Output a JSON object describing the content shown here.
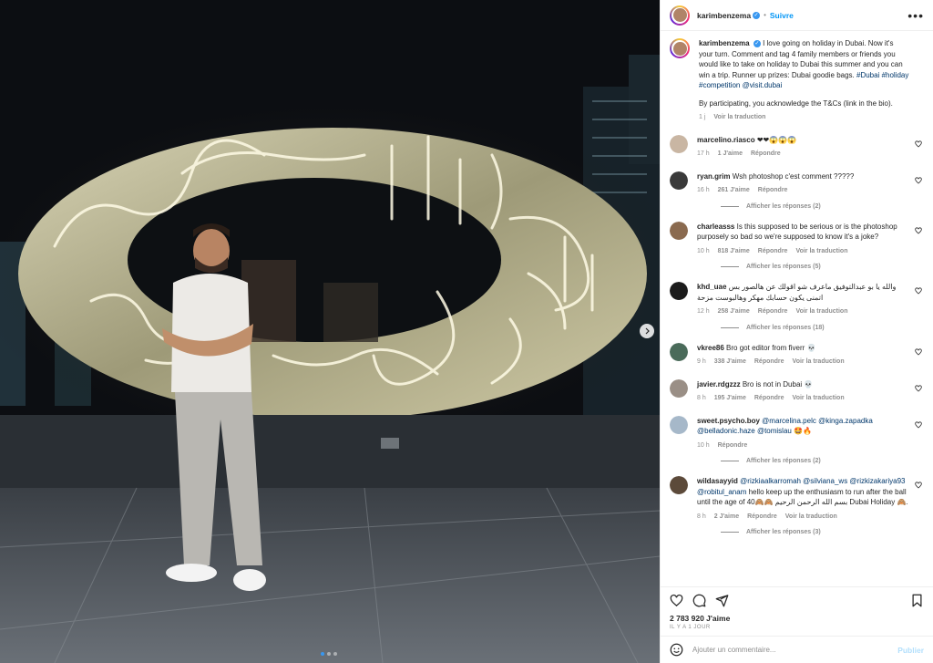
{
  "post": {
    "username": "karimbenzema",
    "follow_label": "Suivre",
    "separator": "•",
    "more_label": "•••",
    "caption": {
      "text": "I love going on holiday in Dubai. Now it's your turn. Comment and tag 4 family members or friends you would like to take on holiday to Dubai this summer and you can win a trip. Runner up prizes: Dubai goodie bags.",
      "tags": "#Dubai #holiday #competition @visit.dubai",
      "paragraph2": "By participating, you acknowledge the T&Cs (link in the bio).",
      "time": "1 j",
      "see_translation": "Voir la traduction"
    }
  },
  "comments": [
    {
      "user": "marcelino.riasco",
      "text": "❤❤😱😱😱",
      "time": "17 h",
      "likes": "1 J'aime",
      "reply": "Répondre",
      "translate": "",
      "replies": "",
      "avatar_color": "#c9b6a3"
    },
    {
      "user": "ryan.grim",
      "text": "Wsh photoshop c'est comment ?????",
      "time": "16 h",
      "likes": "261 J'aime",
      "reply": "Répondre",
      "translate": "",
      "replies": "Afficher les réponses (2)",
      "avatar_color": "#3a3a3a"
    },
    {
      "user": "charleasss",
      "text": "Is this supposed to be serious or is the photoshop purposely so bad so we're supposed to know it's a joke?",
      "time": "10 h",
      "likes": "818 J'aime",
      "reply": "Répondre",
      "translate": "Voir la traduction",
      "replies": "Afficher les réponses (5)",
      "avatar_color": "#8a6a4f"
    },
    {
      "user": "khd_uae",
      "text": "والله يا بو عبدالتوفيق ماعرف شو اقولك عن هالصور بس اتمنى يكون حسابك مهكر وهالبوست مزحة",
      "time": "12 h",
      "likes": "258 J'aime",
      "reply": "Répondre",
      "translate": "Voir la traduction",
      "replies": "Afficher les réponses (18)",
      "avatar_color": "#1b1b1b"
    },
    {
      "user": "vkree86",
      "text": "Bro got editor from fiverr 💀",
      "time": "9 h",
      "likes": "338 J'aime",
      "reply": "Répondre",
      "translate": "Voir la traduction",
      "replies": "",
      "avatar_color": "#4a6b5a"
    },
    {
      "user": "javier.rdgzzz",
      "text": "Bro is not in Dubai 💀",
      "time": "8 h",
      "likes": "195 J'aime",
      "reply": "Répondre",
      "translate": "Voir la traduction",
      "replies": "",
      "avatar_color": "#9a8f86"
    },
    {
      "user": "sweet.psycho.boy",
      "text": "🤩🔥",
      "tags": "@marcelina.pelc @kinga.zapadka @belladonic.haze @tomislau",
      "time": "10 h",
      "likes": "",
      "reply": "Répondre",
      "translate": "",
      "replies": "Afficher les réponses (2)",
      "avatar_color": "#a6b8c9"
    },
    {
      "user": "wildasayyid",
      "text": "hello keep up the enthusiasm to run after the ball until the age of 40🙈🙈 بسم الله الرحمن الرحيم Dubai Holiday 🙈.",
      "tags": "@rizkiaalkarromah @silviana_ws @rizkizakariya93 @robitul_anam",
      "time": "8 h",
      "likes": "2 J'aime",
      "reply": "Répondre",
      "translate": "Voir la traduction",
      "replies": "Afficher les réponses (3)",
      "avatar_color": "#5c4a3a"
    }
  ],
  "footer": {
    "likes": "2 783 920 J'aime",
    "posted": "IL Y A 1 JOUR",
    "add_comment_placeholder": "Ajouter un commentaire...",
    "publish_label": "Publier"
  },
  "colors": {
    "accent": "#0095f6",
    "verified": "#3897f0",
    "tag_link": "#00376b",
    "muted": "#8e8e8e"
  },
  "icons": [
    "heart-icon",
    "comment-icon",
    "share-icon",
    "bookmark-icon",
    "chevron-right-icon",
    "emoji-icon",
    "more-icon",
    "verified-icon"
  ]
}
